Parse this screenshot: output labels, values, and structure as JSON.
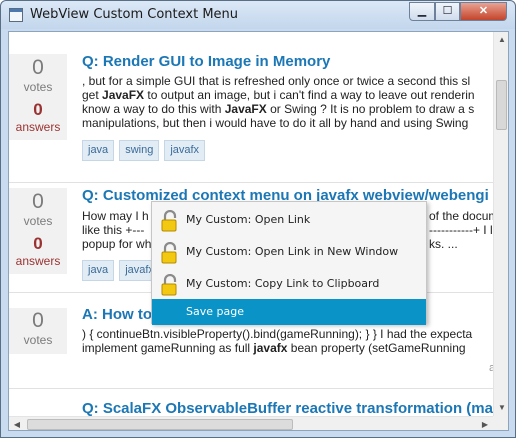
{
  "window": {
    "title": "WebView Custom Context Menu",
    "minimize": "▁",
    "maximize": "☐",
    "close": "✕"
  },
  "questions": [
    {
      "votes": "0",
      "votes_label": "votes",
      "answers": "0",
      "answers_label": "answers",
      "title": "Q: Render GUI to Image in Memory",
      "lines": [
        [
          {
            "t": ", but for a simple GUI that is refreshed only once or twice a second this sl",
            "b": false
          }
        ],
        [
          {
            "t": "get ",
            "b": false
          },
          {
            "t": "JavaFX",
            "b": true
          },
          {
            "t": " to output an image, but i can't find a way to leave out renderin",
            "b": false
          }
        ],
        [
          {
            "t": "know a way to do this with ",
            "b": false
          },
          {
            "t": "JavaFX",
            "b": true
          },
          {
            "t": " or Swing ? It is no problem to draw a s",
            "b": false
          }
        ],
        [
          {
            "t": "manipulations, but then i would have to do it all by hand and using Swing",
            "b": false
          }
        ]
      ],
      "tags": [
        "java",
        "swing",
        "javafx"
      ]
    },
    {
      "votes": "0",
      "votes_label": "votes",
      "answers": "0",
      "answers_label": "answers",
      "title": "Q: Customized context menu on javafx webview/webengi",
      "lines": [
        [
          {
            "t": "How may I h",
            "b": false
          }
        ],
        [
          {
            "t": "like this +---",
            "b": false
          }
        ],
        [
          {
            "t": "popup for wh",
            "b": false
          }
        ]
      ],
      "lines_right": [
        [
          {
            "t": "of the docum",
            "b": false
          }
        ],
        [
          {
            "t": "-----------+ I li",
            "b": false
          }
        ],
        [
          {
            "t": "ks. ...",
            "b": false
          }
        ]
      ],
      "tags": [
        "java",
        "javafx"
      ]
    },
    {
      "votes": "0",
      "votes_label": "votes",
      "title": "A: How to",
      "lines": [
        [
          {
            "t": ") { continueBtn.visibleProperty().bind(gameRunning); } } I had the expecta",
            "b": false
          }
        ],
        [
          {
            "t": "implement gameRunning as full ",
            "b": false
          },
          {
            "t": "javafx",
            "b": true
          },
          {
            "t": " bean property (setGameRunning",
            "b": false
          }
        ]
      ],
      "meta": "a"
    },
    {
      "title": "Q: ScalaFX ObservableBuffer reactive transformation (ma"
    }
  ],
  "context_menu": {
    "items": [
      {
        "label": "My Custom: Open Link",
        "icon": "lock-icon"
      },
      {
        "label": "My Custom: Open Link in New Window",
        "icon": "lock-icon"
      },
      {
        "label": "My Custom: Copy Link to Clipboard",
        "icon": "lock-icon"
      },
      {
        "label": "Save page",
        "icon": ""
      }
    ],
    "selected_index": 3,
    "highlight_color": "#0a93c6"
  }
}
